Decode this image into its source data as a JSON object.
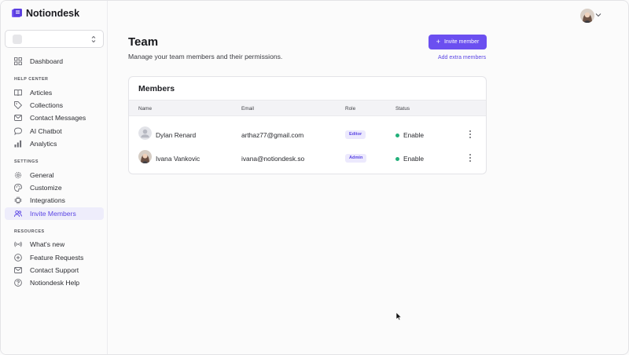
{
  "app": {
    "name": "Notiondesk"
  },
  "workspace": {
    "selected": ""
  },
  "sidebar": {
    "top_items": [
      {
        "label": "Dashboard",
        "icon": "grid-icon"
      }
    ],
    "sections": [
      {
        "label": "HELP CENTER",
        "items": [
          {
            "label": "Articles",
            "icon": "book-icon"
          },
          {
            "label": "Collections",
            "icon": "tag-icon"
          },
          {
            "label": "Contact Messages",
            "icon": "mail-icon"
          },
          {
            "label": "AI Chatbot",
            "icon": "chat-bubble-icon"
          },
          {
            "label": "Analytics",
            "icon": "bar-chart-icon"
          }
        ]
      },
      {
        "label": "SETTINGS",
        "items": [
          {
            "label": "General",
            "icon": "gear-icon"
          },
          {
            "label": "Customize",
            "icon": "palette-icon"
          },
          {
            "label": "Integrations",
            "icon": "plug-icon"
          },
          {
            "label": "Invite Members",
            "icon": "users-icon",
            "active": true
          }
        ]
      },
      {
        "label": "RESOURCES",
        "items": [
          {
            "label": "What's new",
            "icon": "broadcast-icon"
          },
          {
            "label": "Feature Requests",
            "icon": "plus-circle-icon"
          },
          {
            "label": "Contact Support",
            "icon": "mail-icon"
          },
          {
            "label": "Notiondesk Help",
            "icon": "help-circle-icon"
          }
        ]
      }
    ]
  },
  "header": {
    "title": "Team",
    "subtitle": "Manage your team members and their permissions.",
    "invite_button": "Invite member",
    "extra_link": "Add extra members"
  },
  "members": {
    "title": "Members",
    "columns": [
      "Name",
      "Email",
      "Role",
      "Status"
    ],
    "rows": [
      {
        "name": "Dylan Renard",
        "email": "arthaz77@gmail.com",
        "role": "Editor",
        "status": "Enable",
        "avatar": "placeholder"
      },
      {
        "name": "Ivana Vankovic",
        "email": "ivana@notiondesk.so",
        "role": "Admin",
        "status": "Enable",
        "avatar": "photo"
      }
    ]
  },
  "colors": {
    "accent": "#6b4ff0",
    "active_bg": "#eeedfb",
    "status_green": "#22b07a"
  }
}
